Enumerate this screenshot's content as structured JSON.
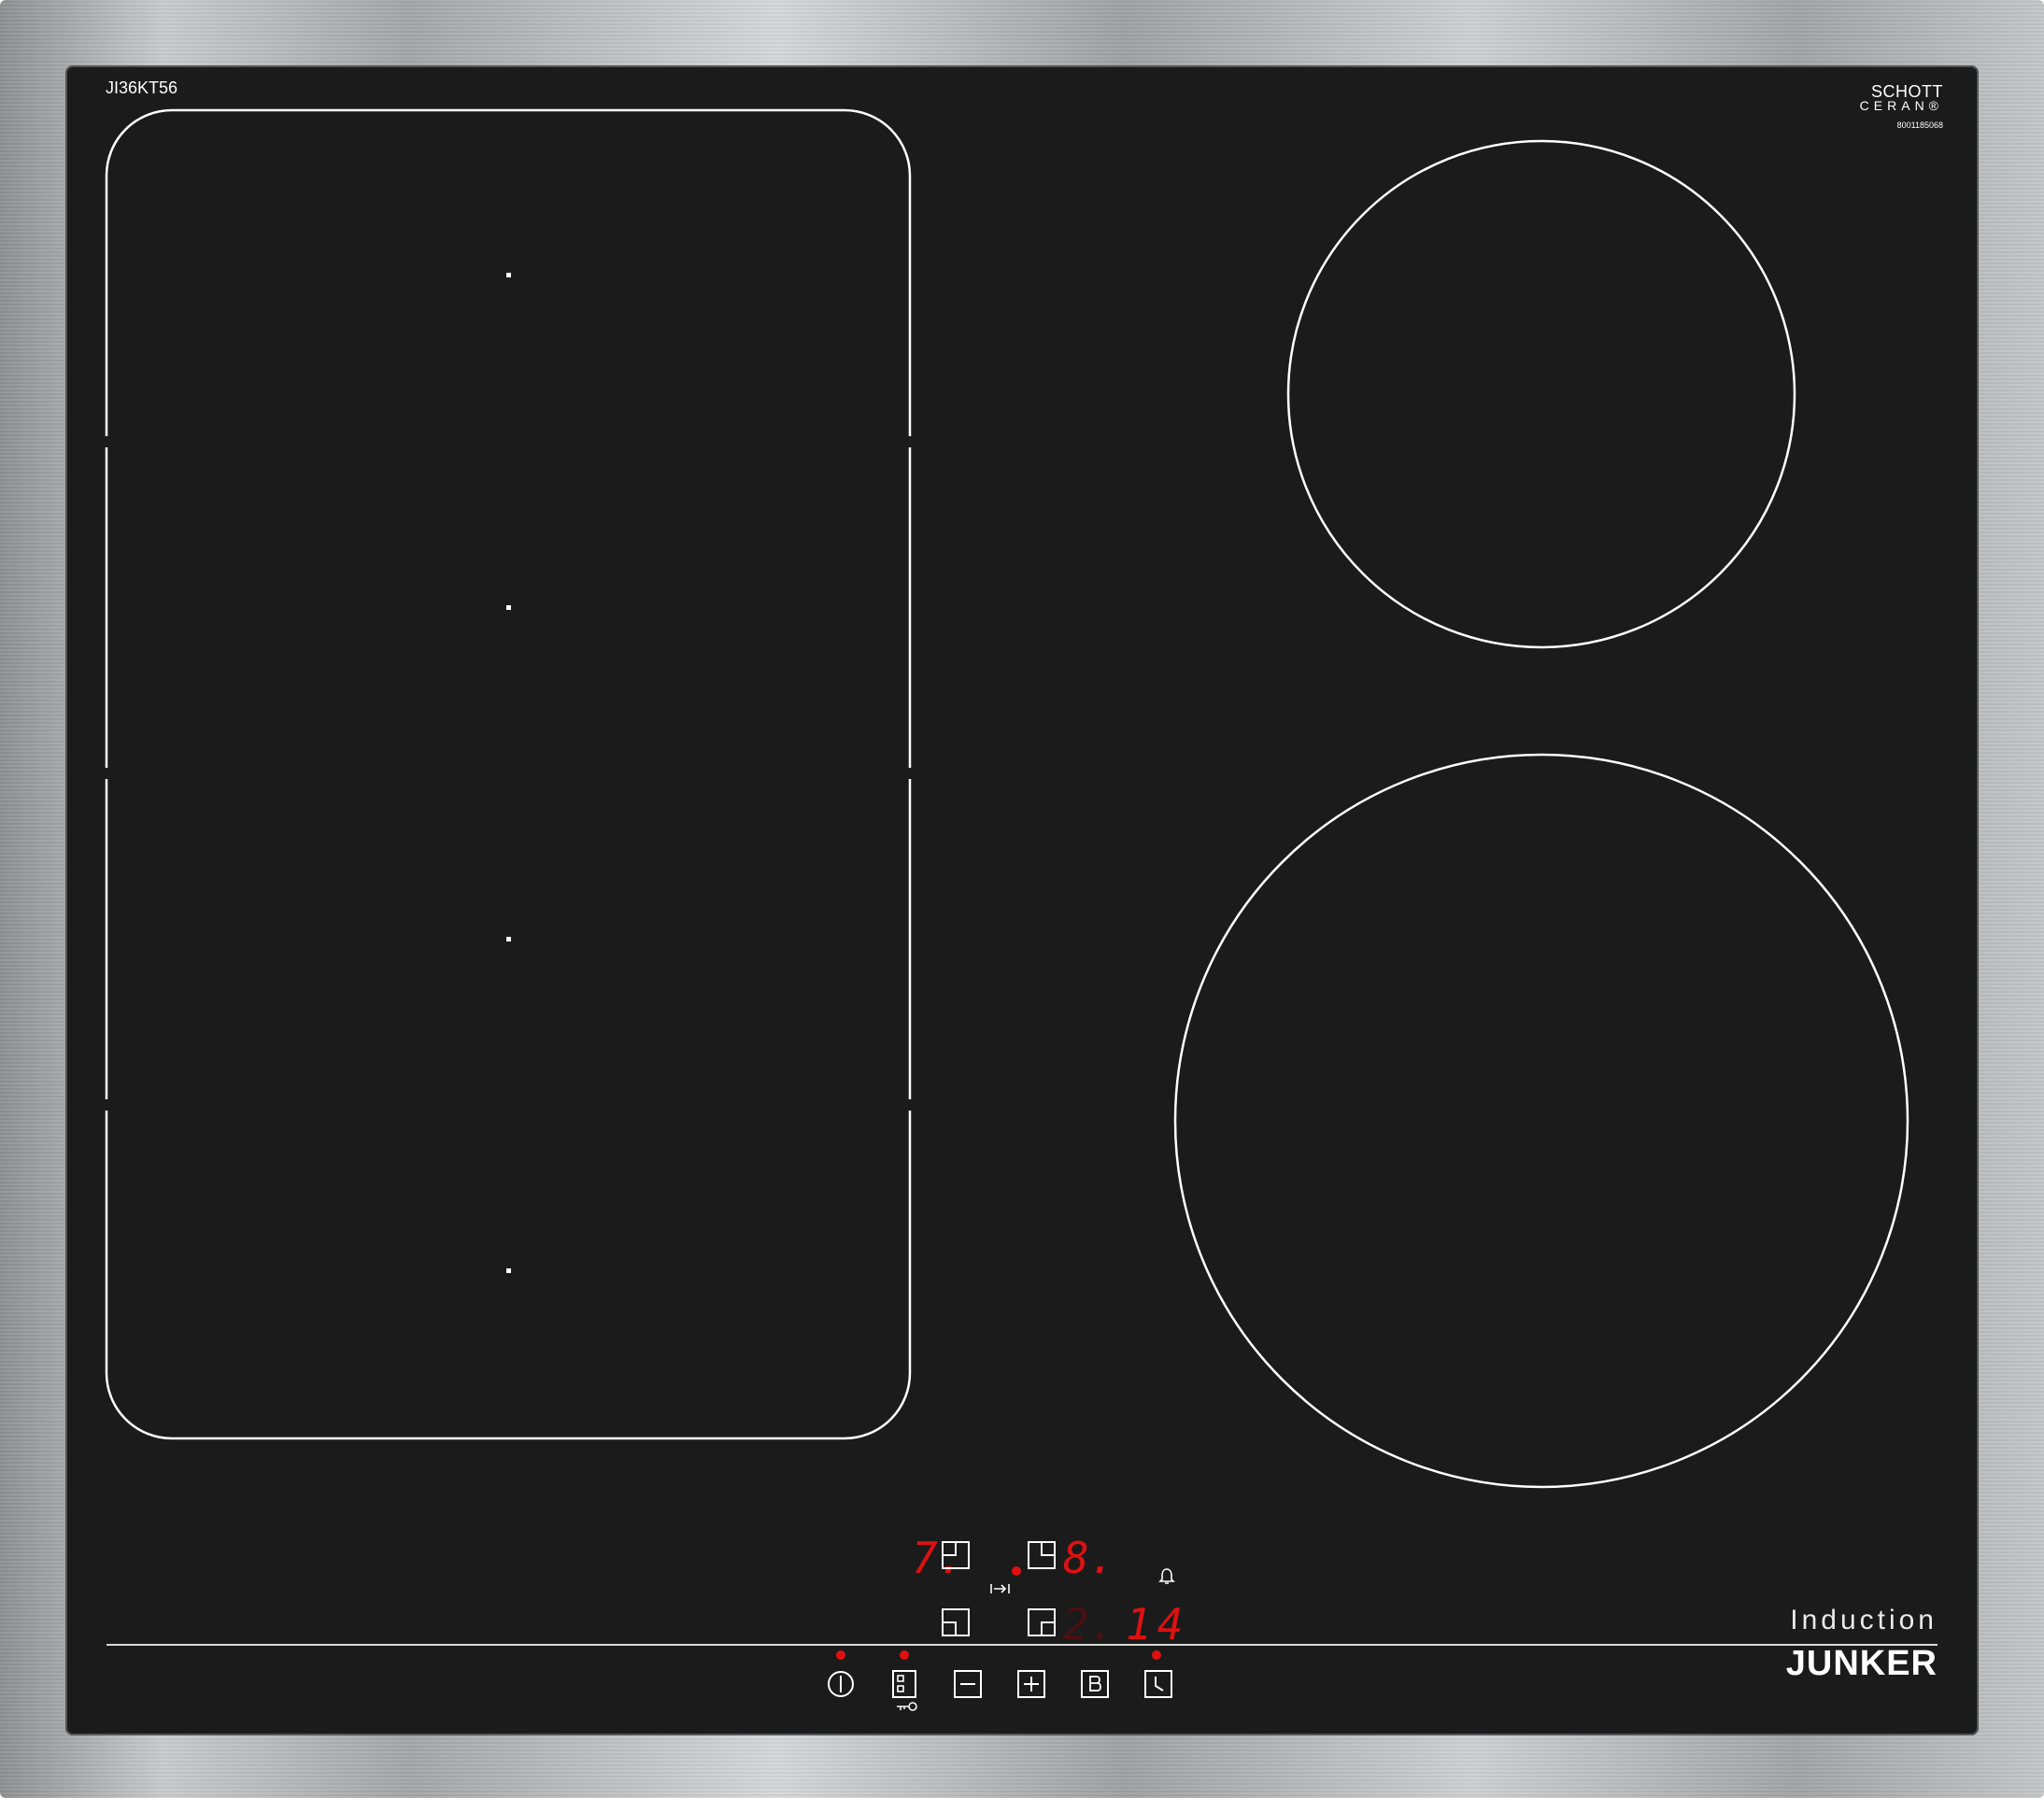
{
  "panel": {
    "model": "JI36KT56",
    "glass_brand_line1": "SCHOTT",
    "glass_brand_line2": "CERAN®",
    "serial": "8001185068",
    "type_label": "Induction",
    "brand": "JUNKER"
  },
  "displays": {
    "left_upper": "7.",
    "right_upper": "8.",
    "right_lower": "2.",
    "timer": "14"
  },
  "icons": {
    "zone_rear_left": "zone-rear-left-icon",
    "zone_rear_right": "zone-rear-right-icon",
    "zone_front_left": "zone-front-left-icon",
    "zone_front_right": "zone-front-right-icon",
    "move": "move-function-icon",
    "alarm": "bell-icon",
    "power": "power-icon",
    "childlock": "childlock-icon",
    "minus": "minus-icon",
    "plus": "plus-icon",
    "boost": "boost-icon",
    "timer": "clock-icon"
  },
  "colors": {
    "glass": "#1b1b1b",
    "display_red": "#dd1111",
    "line_white": "#ffffff"
  }
}
